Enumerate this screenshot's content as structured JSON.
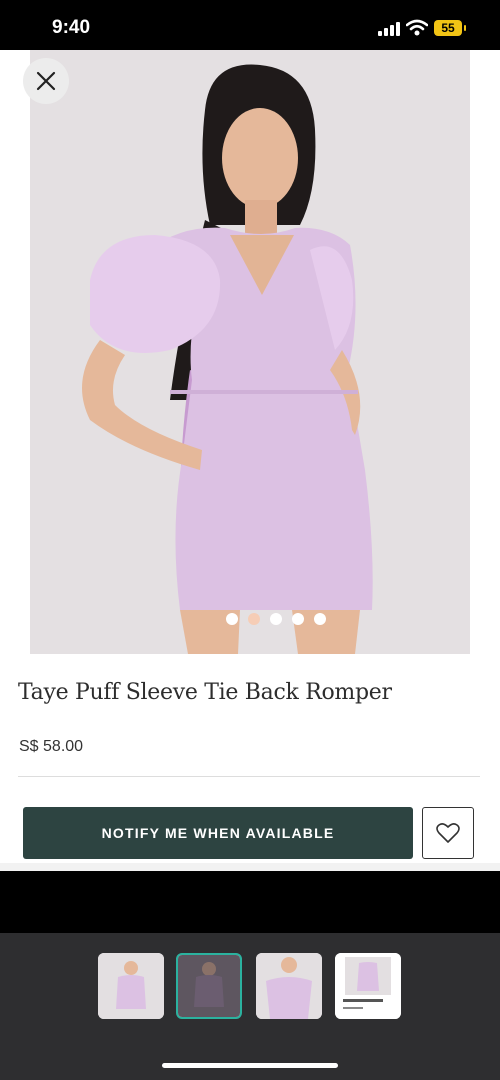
{
  "status_bar": {
    "time": "9:40",
    "battery": "55"
  },
  "product": {
    "title": "Taye Puff Sleeve Tie Back Romper",
    "price": "S$ 58.00",
    "notify_label": "NOTIFY ME WHEN AVAILABLE",
    "carousel_dots": 5,
    "active_dot": 2
  },
  "thumbnails": [
    {
      "name": "thumbnail-1",
      "selected": false
    },
    {
      "name": "thumbnail-2",
      "selected": true
    },
    {
      "name": "thumbnail-3",
      "selected": false
    },
    {
      "name": "thumbnail-4",
      "selected": false
    }
  ],
  "colors": {
    "accent": "#2d4441",
    "selection": "#2bb29f",
    "dress": "#dcc1e3",
    "battery": "#f2c415"
  },
  "icons": [
    "close-icon",
    "heart-icon",
    "signal-icon",
    "wifi-icon",
    "battery-icon"
  ]
}
